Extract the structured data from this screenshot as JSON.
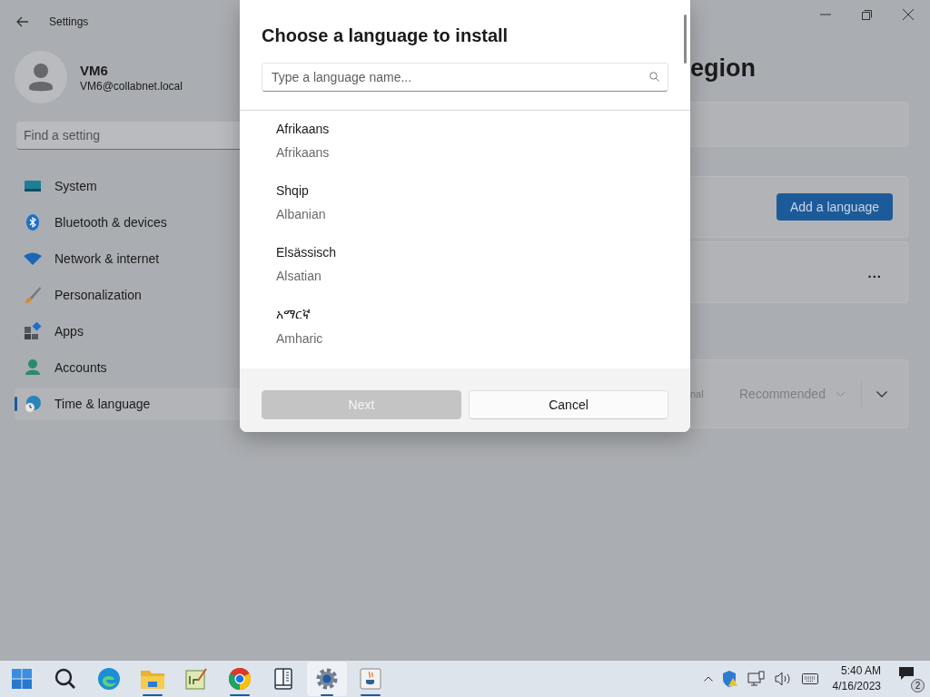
{
  "window": {
    "title": "Settings"
  },
  "user": {
    "name": "VM6",
    "email": "VM6@collabnet.local"
  },
  "search": {
    "placeholder": "Find a setting"
  },
  "nav": [
    {
      "label": "System",
      "selected": false
    },
    {
      "label": "Bluetooth & devices",
      "selected": false
    },
    {
      "label": "Network & internet",
      "selected": false
    },
    {
      "label": "Personalization",
      "selected": false
    },
    {
      "label": "Apps",
      "selected": false
    },
    {
      "label": "Accounts",
      "selected": false
    },
    {
      "label": "Time & language",
      "selected": true
    }
  ],
  "page": {
    "title_fragment": "egion",
    "add_button": "Add a language",
    "more": "...",
    "row_fragment": "nal",
    "dropdown": "Recommended"
  },
  "dialog": {
    "title": "Choose a language to install",
    "search": {
      "placeholder": "Type a language name..."
    },
    "languages": [
      {
        "name": "Afrikaans",
        "english": "Afrikaans"
      },
      {
        "name": "Shqip",
        "english": "Albanian"
      },
      {
        "name": "Elsässisch",
        "english": "Alsatian"
      },
      {
        "name": "አማርኛ",
        "english": "Amharic"
      }
    ],
    "buttons": [
      {
        "label": "Next",
        "disabled": true
      },
      {
        "label": "Cancel",
        "disabled": false
      }
    ]
  },
  "taskbar": {
    "apps": [
      {
        "running": false,
        "selected": false
      },
      {
        "running": false,
        "selected": false
      },
      {
        "running": false,
        "selected": false
      },
      {
        "running": true,
        "selected": false
      },
      {
        "running": false,
        "selected": false
      },
      {
        "running": true,
        "selected": false
      },
      {
        "running": false,
        "selected": false
      },
      {
        "running": true,
        "selected": true
      },
      {
        "running": true,
        "selected": false
      }
    ]
  },
  "tray": {
    "time": "5:40 AM",
    "date": "4/16/2023",
    "notifications": "2"
  }
}
